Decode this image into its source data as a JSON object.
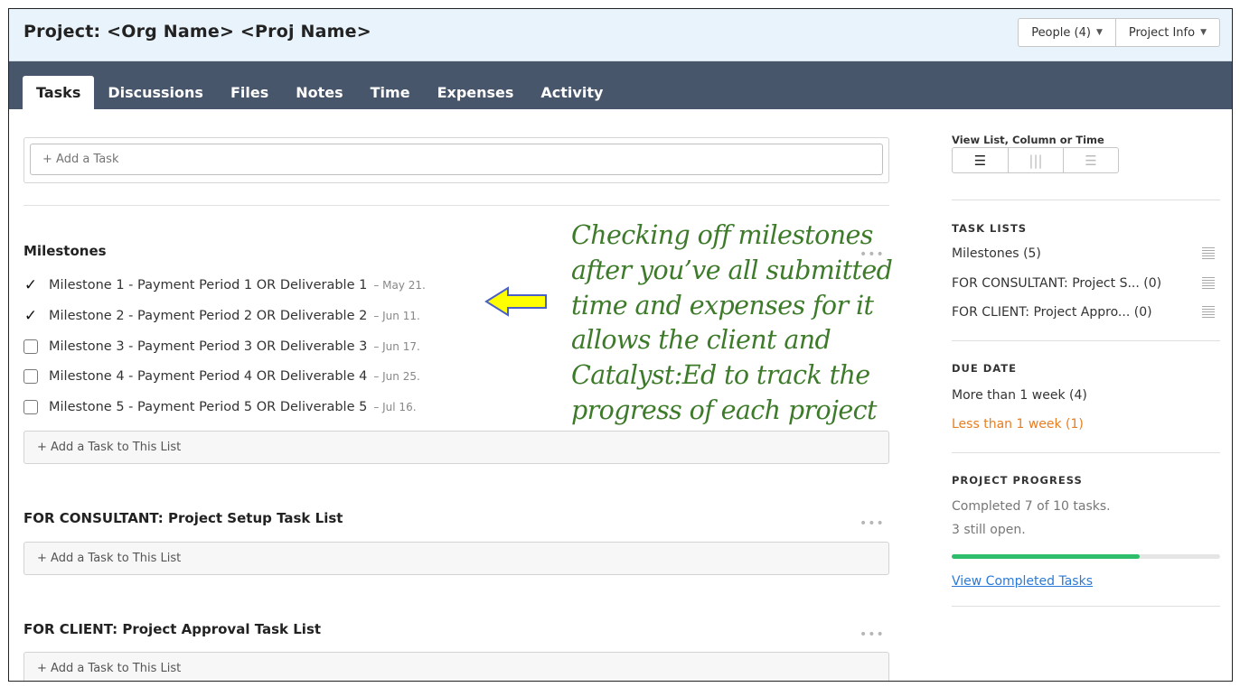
{
  "header": {
    "title": "Project: <Org Name> <Proj Name>",
    "people_button": "People (4)",
    "project_info_button": "Project Info"
  },
  "nav": {
    "tabs": [
      "Tasks",
      "Discussions",
      "Files",
      "Notes",
      "Time",
      "Expenses",
      "Activity"
    ],
    "active": "Tasks"
  },
  "main": {
    "add_task_placeholder": "+ Add a Task",
    "add_to_list_label": "+ Add a Task to This List",
    "lists": [
      {
        "title": "Milestones",
        "items": [
          {
            "label": "Milestone 1 - Payment Period 1 OR Deliverable 1",
            "date": "– May 21.",
            "done": true
          },
          {
            "label": "Milestone 2 - Payment Period 2 OR Deliverable 2",
            "date": "– Jun 11.",
            "done": true
          },
          {
            "label": "Milestone 3 - Payment Period 3 OR Deliverable 3",
            "date": "– Jun 17.",
            "done": false
          },
          {
            "label": "Milestone 4 - Payment Period 4 OR Deliverable 4",
            "date": "– Jun 25.",
            "done": false
          },
          {
            "label": "Milestone 5 - Payment Period 5 OR Deliverable 5",
            "date": "– Jul 16.",
            "done": false
          }
        ]
      },
      {
        "title": "FOR CONSULTANT: Project Setup Task List",
        "items": []
      },
      {
        "title": "FOR CLIENT: Project Approval Task List",
        "items": []
      }
    ],
    "more_glyph": "•••"
  },
  "annotation": {
    "lines": [
      "Checking off milestones",
      "after you’ve all submitted",
      "time and expenses for it",
      "allows the client and",
      "Catalyst:Ed to track the",
      "progress of each project"
    ],
    "color": "#3d7a2a",
    "arrow_color": "#ffff00"
  },
  "sidebar": {
    "view_label": "View List, Column or Time",
    "view_icons": [
      "list-view-icon",
      "column-view-icon",
      "timeline-view-icon"
    ],
    "task_lists_heading": "TASK LISTS",
    "task_lists": [
      {
        "name": "Milestones",
        "count": "(5)"
      },
      {
        "name": "FOR CONSULTANT: Project S...",
        "count": "(0)"
      },
      {
        "name": "FOR CLIENT: Project Appro...",
        "count": "(0)"
      }
    ],
    "due_date_heading": "DUE DATE",
    "due_more": "More than 1 week (4)",
    "due_less": "Less than 1 week (1)",
    "progress_heading": "PROJECT PROGRESS",
    "progress_line1": "Completed 7 of 10 tasks.",
    "progress_line2": "3 still open.",
    "progress_fraction": 0.7,
    "progress_color": "#2ebd6b",
    "view_completed": "View Completed Tasks"
  }
}
